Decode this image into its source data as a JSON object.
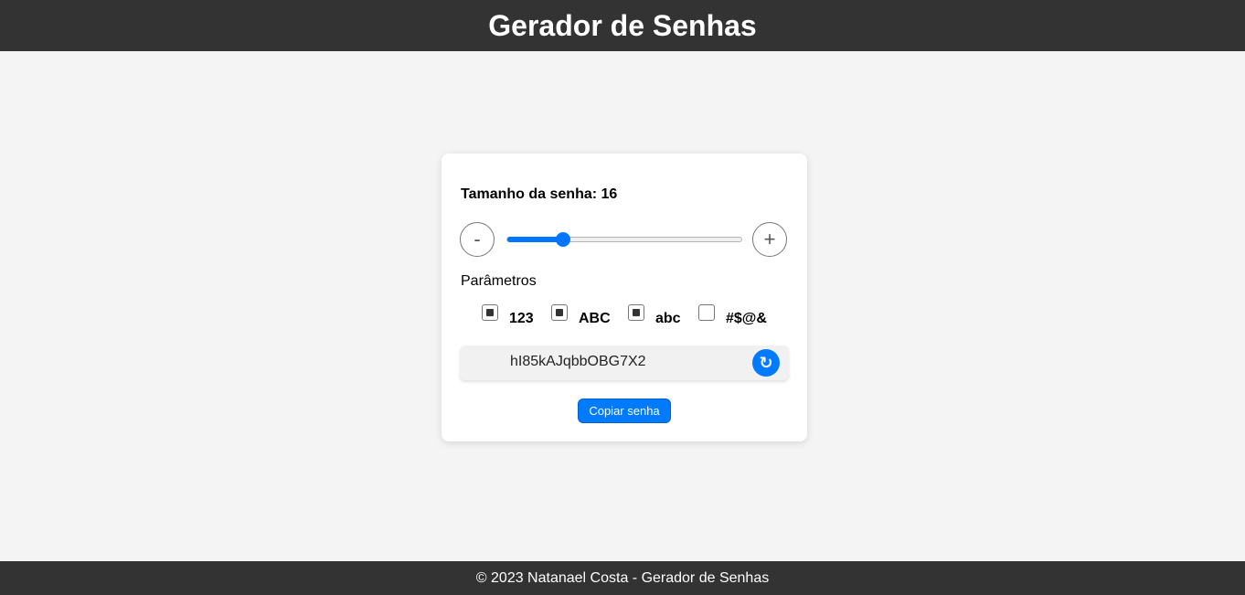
{
  "header": {
    "title": "Gerador de Senhas"
  },
  "generator": {
    "size_label": "Tamanho da senha: 16",
    "minus_label": "-",
    "plus_label": "+",
    "slider": {
      "value": 16,
      "fill_fraction": 0.24
    },
    "params_label": "Parâmetros",
    "options": [
      {
        "label": "123",
        "checked": true
      },
      {
        "label": "ABC",
        "checked": true
      },
      {
        "label": "abc",
        "checked": true
      },
      {
        "label": "#$@&",
        "checked": false
      }
    ],
    "password": "hI85kAJqbbOBG7X2",
    "refresh_icon": "↻",
    "copy_label": "Copiar senha"
  },
  "footer": {
    "text": "© 2023 Natanael Costa - Gerador de Senhas"
  },
  "colors": {
    "accent": "#007bff",
    "bar": "#333333",
    "background": "#f4f4f4"
  }
}
